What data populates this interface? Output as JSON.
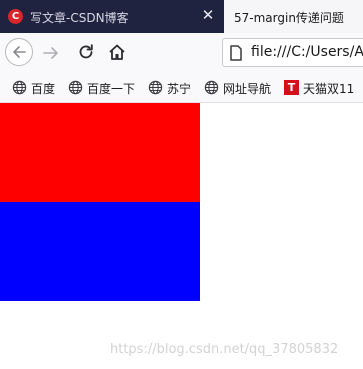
{
  "tabs": [
    {
      "favicon_letter": "C",
      "title": "写文章-CSDN博客",
      "close": "✕"
    },
    {
      "title": "57-margin传递问题"
    }
  ],
  "address_bar": {
    "url": "file:///C:/Users/A"
  },
  "bookmarks": [
    {
      "label": "百度",
      "icon": "globe-icon"
    },
    {
      "label": "百度一下",
      "icon": "globe-icon"
    },
    {
      "label": "苏宁",
      "icon": "globe-icon"
    },
    {
      "label": "网址导航",
      "icon": "globe-icon"
    },
    {
      "label": "天猫双11",
      "icon": "tmall-icon",
      "icon_letter": "T"
    }
  ],
  "content": {
    "boxes": [
      {
        "color": "#ff0000"
      },
      {
        "color": "#0000ff"
      }
    ],
    "watermark": "https://blog.csdn.net/qq_37805832"
  },
  "colors": {
    "tab_strip": "#202340",
    "active_tab": "#f6f6f8",
    "toolbar": "#f9f9fb"
  }
}
